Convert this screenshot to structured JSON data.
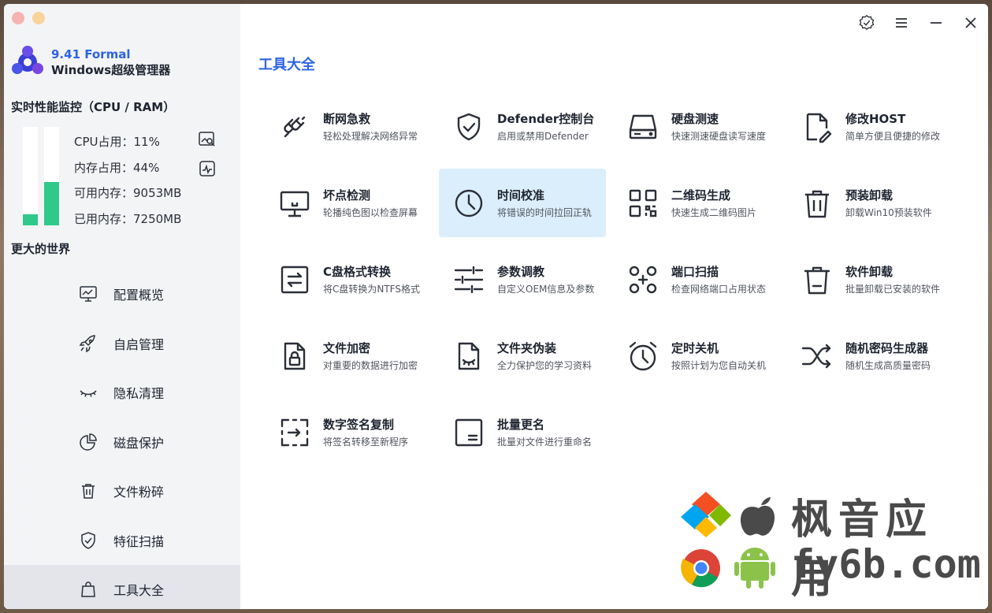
{
  "app": {
    "version": "9.41 Formal",
    "name": "Windows超级管理器"
  },
  "perf": {
    "title": "实时性能监控（CPU / RAM）",
    "cpu_percent": 11,
    "mem_percent": 44,
    "cpu_usage": "CPU占用：11%",
    "mem_usage": "内存占用：44%",
    "available_mem": "可用内存：9053MB",
    "used_mem": "已用内存：7250MB"
  },
  "sidebar": {
    "section_title": "更大的世界",
    "items": [
      {
        "label": "配置概览",
        "icon": "monitor-chart-icon"
      },
      {
        "label": "自启管理",
        "icon": "rocket-icon"
      },
      {
        "label": "隐私清理",
        "icon": "closed-eye-icon"
      },
      {
        "label": "磁盘保护",
        "icon": "pie-chart-icon"
      },
      {
        "label": "文件粉碎",
        "icon": "trash-icon"
      },
      {
        "label": "特征扫描",
        "icon": "shield-check-icon"
      },
      {
        "label": "工具大全",
        "icon": "bag-icon"
      }
    ],
    "active_index": 6
  },
  "main": {
    "title": "工具大全",
    "tools": [
      {
        "name": "断网急救",
        "desc": "轻松处理解决网络异常",
        "icon": "plug-icon"
      },
      {
        "name": "Defender控制台",
        "desc": "启用或禁用Defender",
        "icon": "shield-check-icon"
      },
      {
        "name": "硬盘测速",
        "desc": "快速测速硬盘读写速度",
        "icon": "harddisk-icon"
      },
      {
        "name": "修改HOST",
        "desc": "简单方便且便捷的修改",
        "icon": "file-edit-icon"
      },
      {
        "name": "坏点检测",
        "desc": "轮播纯色图以检查屏幕",
        "icon": "monitor-icon"
      },
      {
        "name": "时间校准",
        "desc": "将错误的时间拉回正轨",
        "icon": "clock-icon"
      },
      {
        "name": "二维码生成",
        "desc": "快速生成二维码图片",
        "icon": "qrcode-icon"
      },
      {
        "name": "预装卸载",
        "desc": "卸载Win10预装软件",
        "icon": "trash-icon"
      },
      {
        "name": "C盘格式转换",
        "desc": "将C盘转换为NTFS格式",
        "icon": "convert-icon"
      },
      {
        "name": "参数调教",
        "desc": "自定义OEM信息及参数",
        "icon": "sliders-icon"
      },
      {
        "name": "端口扫描",
        "desc": "检查网络端口占用状态",
        "icon": "port-scan-icon"
      },
      {
        "name": "软件卸载",
        "desc": "批量卸载已安装的软件",
        "icon": "bin-icon"
      },
      {
        "name": "文件加密",
        "desc": "对重要的数据进行加密",
        "icon": "file-lock-icon"
      },
      {
        "name": "文件夹伪装",
        "desc": "全力保护您的学习资料",
        "icon": "file-hidden-icon"
      },
      {
        "name": "定时关机",
        "desc": "按照计划为您自动关机",
        "icon": "alarm-clock-icon"
      },
      {
        "name": "随机密码生成器",
        "desc": "随机生成高质量密码",
        "icon": "shuffle-icon"
      },
      {
        "name": "数字签名复制",
        "desc": "将签名转移至新程序",
        "icon": "signature-transfer-icon"
      },
      {
        "name": "批量更名",
        "desc": "批量对文件进行重命名",
        "icon": "rename-icon"
      }
    ],
    "selected_index": 5
  },
  "watermark": {
    "line1": "枫音应用",
    "line2": "fy6b.com"
  },
  "colors": {
    "accent": "#2c63e6",
    "bar_fill": "#2ec98b",
    "selected_tool_bg": "#dbeefb",
    "sidebar_bg": "#f3f4f6"
  }
}
